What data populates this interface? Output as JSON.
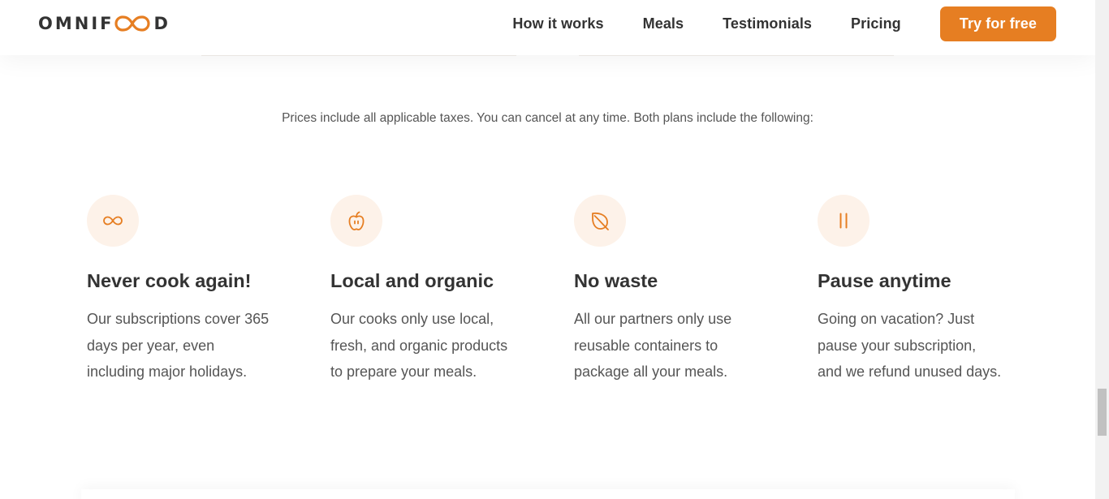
{
  "header": {
    "logo": {
      "left_text": "OMNIF",
      "right_text": "D"
    },
    "nav": {
      "links": [
        {
          "label": "How it works"
        },
        {
          "label": "Meals"
        },
        {
          "label": "Testimonials"
        },
        {
          "label": "Pricing"
        }
      ],
      "cta_label": "Try for free"
    }
  },
  "pricing": {
    "plan_details": "Prices include all applicable taxes. You can cancel at any time. Both plans include the following:"
  },
  "features": [
    {
      "icon": "infinity-icon",
      "title": "Never cook again!",
      "lines": [
        "Our subscriptions cover 365",
        "days per year, even",
        "including major holidays."
      ]
    },
    {
      "icon": "apple-icon",
      "title": "Local and organic",
      "lines": [
        "Our cooks only use local,",
        "fresh, and organic products",
        "to prepare your meals."
      ]
    },
    {
      "icon": "leaf-icon",
      "title": "No waste",
      "lines": [
        "All our partners only use",
        "reusable containers to",
        "package all your meals."
      ]
    },
    {
      "icon": "pause-icon",
      "title": "Pause anytime",
      "lines": [
        "Going on vacation? Just",
        "pause your subscription,",
        "and we refund unused days."
      ]
    }
  ],
  "colors": {
    "accent": "#e67e22",
    "accent_tint": "#fdf2e9",
    "heading": "#333333",
    "body_text": "#555555"
  }
}
